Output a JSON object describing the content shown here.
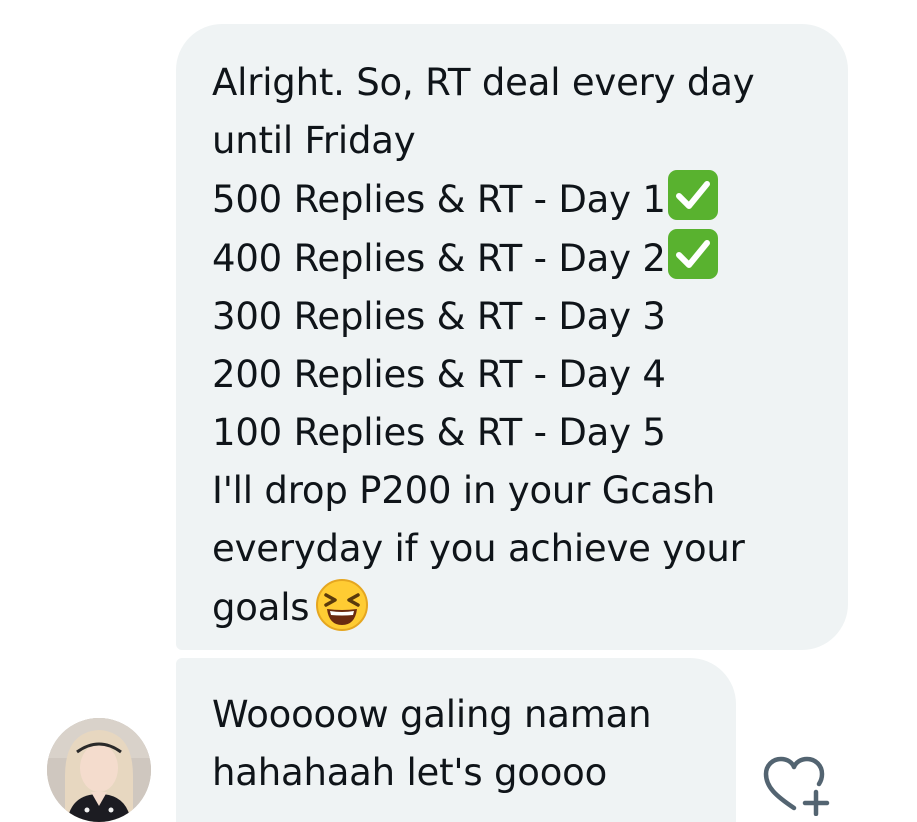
{
  "conversation": {
    "message_1": {
      "lines": [
        "Alright. So, RT deal every day",
        "until Friday",
        "500 Replies & RT - Day 1",
        "400 Replies & RT - Day 2",
        "300 Replies & RT - Day 3",
        "200 Replies & RT - Day 4",
        "100 Replies & RT - Day 5",
        "I'll drop P200 in your Gcash",
        "everyday if you achieve your",
        "goals"
      ]
    },
    "message_2": {
      "lines": [
        "Wooooow galing naman",
        "hahahaah let's goooo"
      ]
    }
  },
  "icons": {
    "check": "white-check-mark-emoji",
    "laugh": "grinning-squinting-face-emoji",
    "react": "heart-plus-icon"
  },
  "colors": {
    "bubble_bg": "#eff3f4",
    "text": "#0f1419",
    "check_green": "#59b22f",
    "icon_gray": "#536471"
  }
}
